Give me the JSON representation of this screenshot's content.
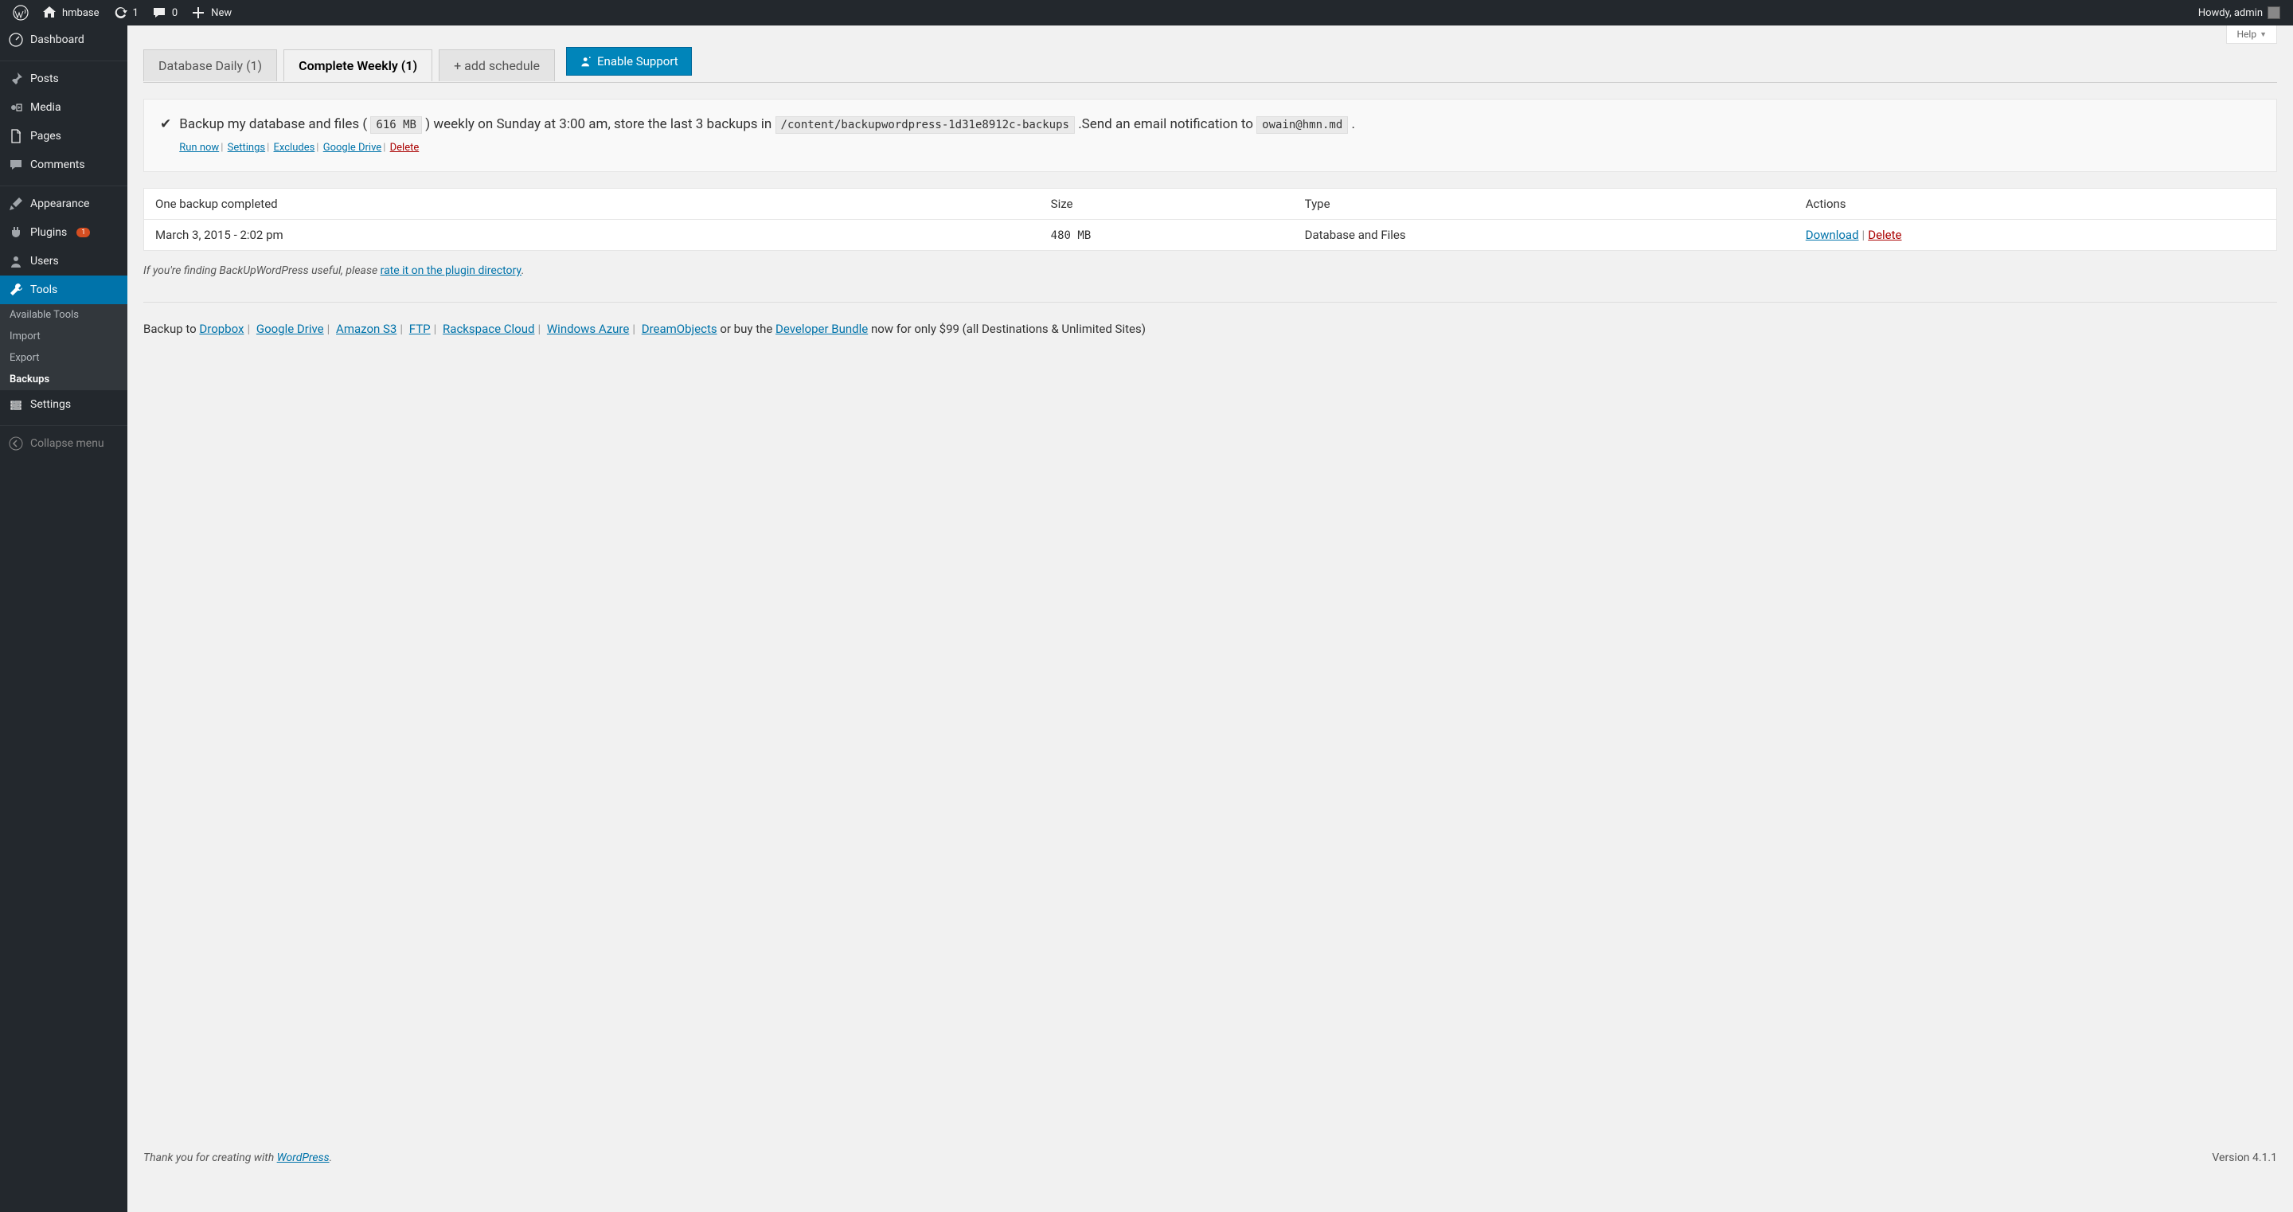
{
  "adminbar": {
    "site_name": "hmbase",
    "refresh_count": "1",
    "comment_count": "0",
    "new_label": "New",
    "howdy": "Howdy, admin"
  },
  "sidebar": {
    "items": [
      {
        "label": "Dashboard"
      },
      {
        "label": "Posts"
      },
      {
        "label": "Media"
      },
      {
        "label": "Pages"
      },
      {
        "label": "Comments"
      },
      {
        "label": "Appearance"
      },
      {
        "label": "Plugins",
        "badge": "1"
      },
      {
        "label": "Users"
      },
      {
        "label": "Tools"
      },
      {
        "label": "Settings"
      }
    ],
    "tools_submenu": [
      {
        "label": "Available Tools"
      },
      {
        "label": "Import"
      },
      {
        "label": "Export"
      },
      {
        "label": "Backups"
      }
    ],
    "collapse": "Collapse menu"
  },
  "help_label": "Help",
  "tabs": {
    "daily": "Database Daily (1)",
    "weekly": "Complete Weekly (1)",
    "add": "+ add schedule",
    "enable_support": "Enable Support"
  },
  "sentence": {
    "pre_size": "Backup my database and files (",
    "size": "616 MB",
    "post_size": ") weekly on Sunday at 3:00 am, store the last 3 backups in",
    "path": "/content/backupwordpress-1d31e8912c-backups",
    "post_path": ".Send an email notification to",
    "email": "owain@hmn.md",
    "final": ".",
    "run_now": "Run now",
    "settings": "Settings",
    "excludes": "Excludes",
    "gdrive": "Google Drive",
    "delete": "Delete"
  },
  "table": {
    "headers": {
      "completed": "One backup completed",
      "size": "Size",
      "type": "Type",
      "actions": "Actions"
    },
    "row": {
      "date": "March 3, 2015 - 2:02 pm",
      "size": "480 MB",
      "type": "Database and Files",
      "download": "Download",
      "delete": "Delete"
    }
  },
  "promo": {
    "prefix": "If you're finding BackUpWordPress useful, please ",
    "link": "rate it on the plugin directory",
    "suffix": "."
  },
  "backup_to": {
    "label": "Backup to ",
    "links": [
      "Dropbox",
      "Google Drive",
      "Amazon S3",
      "FTP",
      "Rackspace Cloud",
      "Windows Azure",
      "DreamObjects"
    ],
    "or_buy": "  or buy the ",
    "bundle": "Developer Bundle",
    "price": " now for only $99 (all Destinations & Unlimited Sites)"
  },
  "footer": {
    "thanks_prefix": "Thank you for creating with ",
    "wp": "WordPress",
    "thanks_suffix": ".",
    "version": "Version 4.1.1"
  }
}
